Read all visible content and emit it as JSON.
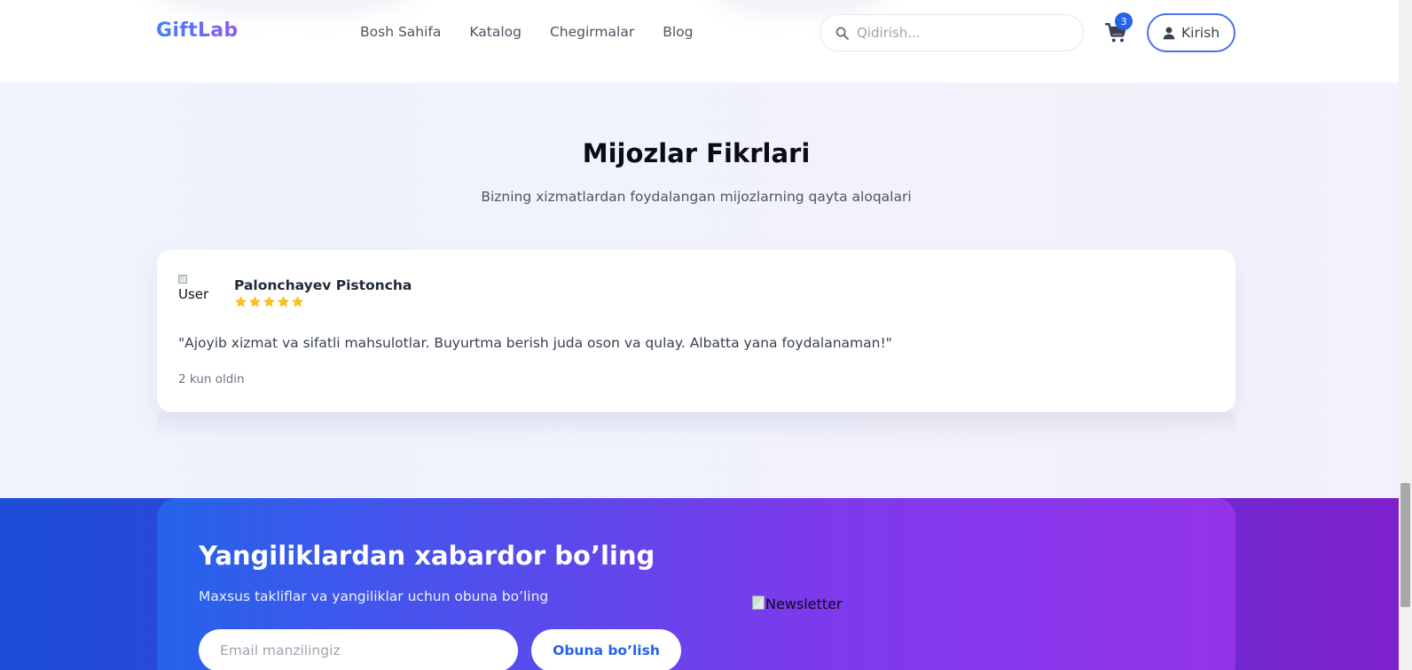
{
  "header": {
    "logo": "GiftLab",
    "nav": [
      "Bosh Sahifa",
      "Katalog",
      "Chegirmalar",
      "Blog"
    ],
    "search_placeholder": "Qidirish...",
    "cart_count": "3",
    "login_label": "Kirish"
  },
  "testimonials": {
    "title": "Mijozlar Fikrlari",
    "subtitle": "Bizning xizmatlardan foydalangan mijozlarning qayta aloqalari",
    "review": {
      "avatar_alt": "User",
      "name": "Palonchayev Pistoncha",
      "rating": 5,
      "quote": "\"Ajoyib xizmat va sifatli mahsulotlar. Buyurtma berish juda oson va qulay. Albatta yana foydalanaman!\"",
      "time": "2 kun oldin"
    }
  },
  "newsletter": {
    "title": "Yangiliklardan xabardor bo’ling",
    "subtitle": "Maxsus takliflar va yangiliklar uchun obuna bo’ling",
    "email_placeholder": "Email manzilingiz",
    "subscribe_label": "Obuna bo’lish",
    "image_alt": "Newsletter"
  },
  "colors": {
    "accent": "#2563eb",
    "star": "#fbbf24",
    "gradient_start": "#2563eb",
    "gradient_end": "#9333ea"
  }
}
